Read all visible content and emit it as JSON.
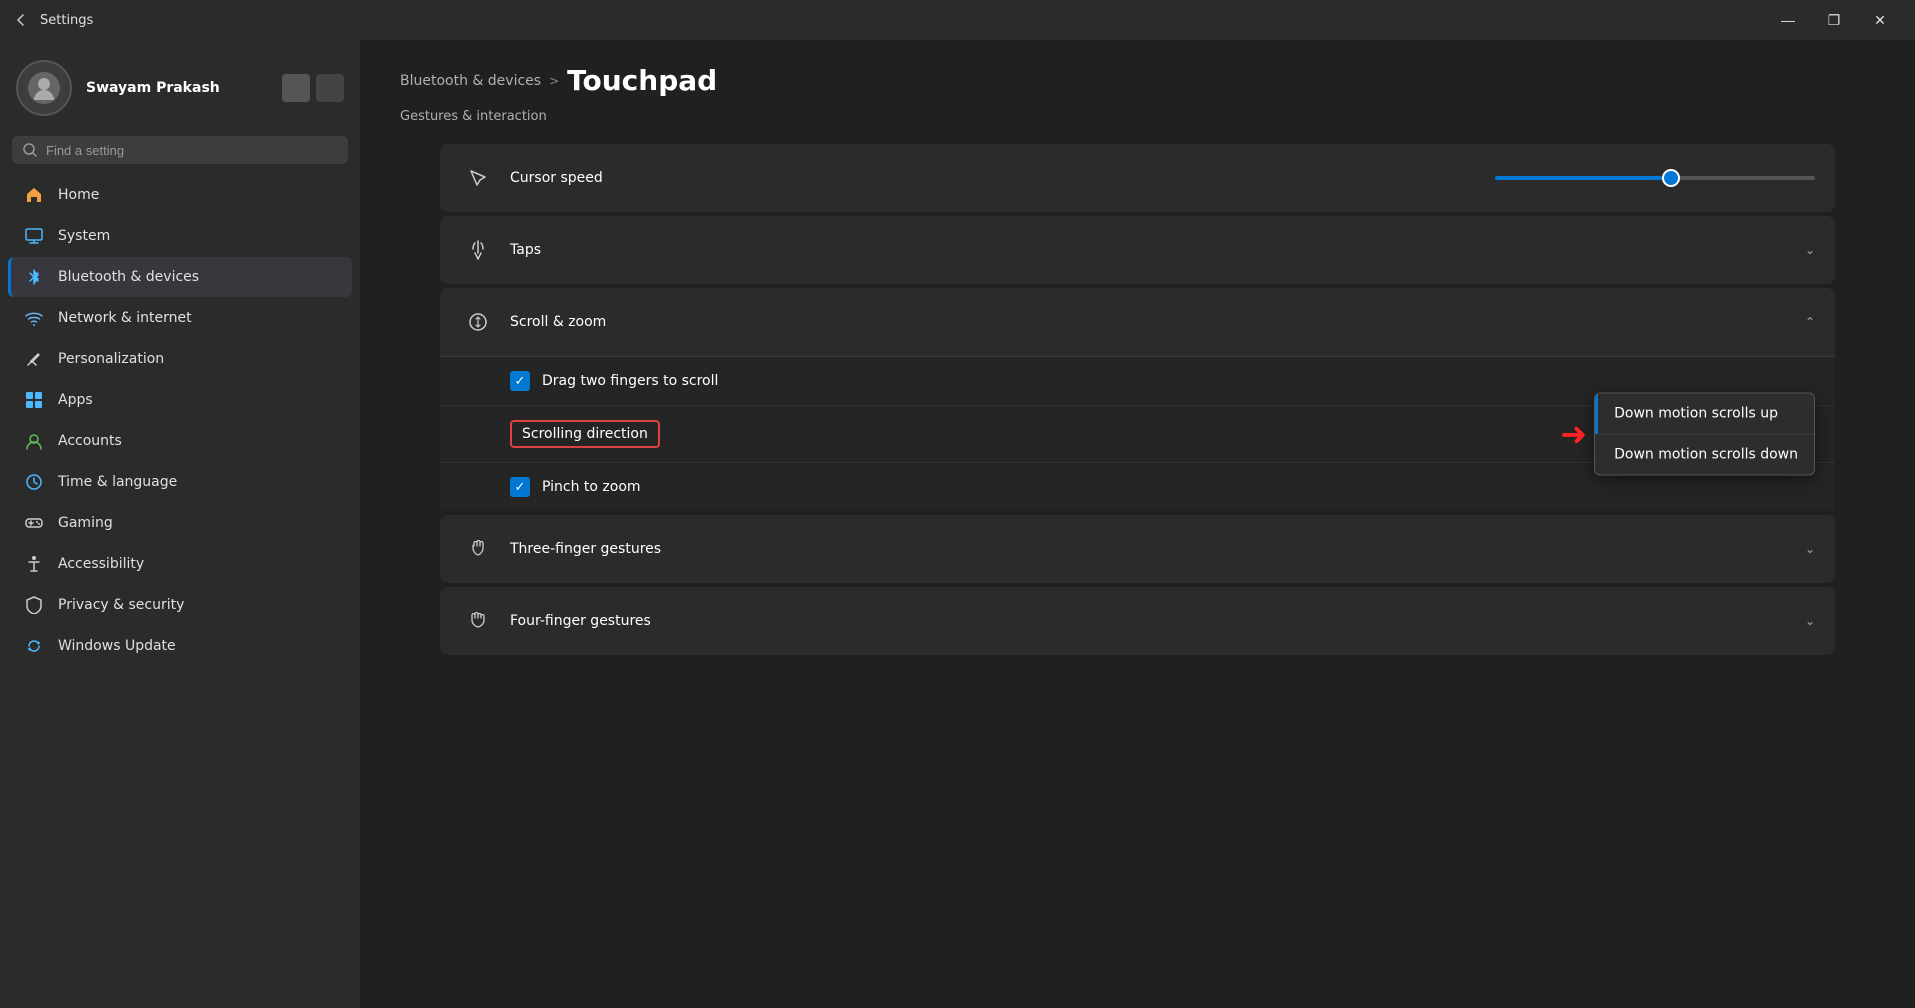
{
  "titlebar": {
    "title": "Settings",
    "minimize": "—",
    "maximize": "❐",
    "close": "✕"
  },
  "sidebar": {
    "user_name": "Swayam Prakash",
    "search_placeholder": "Find a setting",
    "nav_items": [
      {
        "id": "home",
        "label": "Home",
        "icon": "🏠"
      },
      {
        "id": "system",
        "label": "System",
        "icon": "🖥"
      },
      {
        "id": "bluetooth",
        "label": "Bluetooth & devices",
        "icon": "🔵",
        "active": true
      },
      {
        "id": "network",
        "label": "Network & internet",
        "icon": "📶"
      },
      {
        "id": "personalization",
        "label": "Personalization",
        "icon": "✏️"
      },
      {
        "id": "apps",
        "label": "Apps",
        "icon": "🟦"
      },
      {
        "id": "accounts",
        "label": "Accounts",
        "icon": "🟢"
      },
      {
        "id": "time",
        "label": "Time & language",
        "icon": "🕐"
      },
      {
        "id": "gaming",
        "label": "Gaming",
        "icon": "🎮"
      },
      {
        "id": "accessibility",
        "label": "Accessibility",
        "icon": "♿"
      },
      {
        "id": "privacy",
        "label": "Privacy & security",
        "icon": "🛡"
      },
      {
        "id": "update",
        "label": "Windows Update",
        "icon": "🔄"
      }
    ]
  },
  "content": {
    "breadcrumb_link": "Bluetooth & devices",
    "breadcrumb_sep": ">",
    "page_title": "Touchpad",
    "section_label": "Gestures & interaction",
    "settings": [
      {
        "id": "cursor-speed",
        "label": "Cursor speed",
        "icon": "cursor",
        "control": "slider",
        "slider_percent": 55
      },
      {
        "id": "taps",
        "label": "Taps",
        "icon": "tap",
        "control": "expand",
        "expanded": false
      },
      {
        "id": "scroll-zoom",
        "label": "Scroll & zoom",
        "icon": "scroll",
        "control": "expand",
        "expanded": true,
        "sub_items": [
          {
            "id": "drag-scroll",
            "label": "Drag two fingers to scroll",
            "type": "checkbox",
            "checked": true
          },
          {
            "id": "scrolling-direction",
            "label": "Scrolling direction",
            "type": "dropdown",
            "selected": "Down motion scrolls up",
            "options": [
              "Down motion scrolls up",
              "Down motion scrolls down"
            ]
          },
          {
            "id": "pinch-zoom",
            "label": "Pinch to zoom",
            "type": "checkbox",
            "checked": true
          }
        ]
      },
      {
        "id": "three-finger",
        "label": "Three-finger gestures",
        "icon": "three-finger",
        "control": "expand",
        "expanded": false
      },
      {
        "id": "four-finger",
        "label": "Four-finger gestures",
        "icon": "four-finger",
        "control": "expand",
        "expanded": false
      }
    ]
  }
}
